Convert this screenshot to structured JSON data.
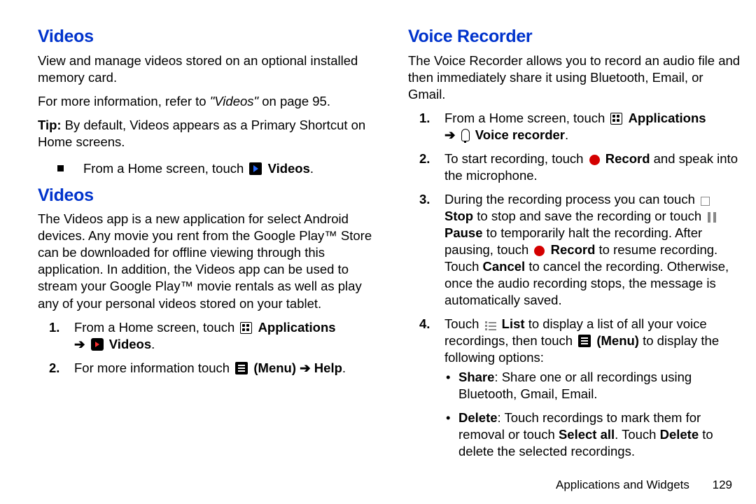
{
  "left": {
    "h1": "Videos",
    "p1": "View and manage videos stored on an optional installed memory card.",
    "p2a": "For more information, refer to ",
    "p2b": "\"Videos\"",
    "p2c": " on page 95.",
    "tipLabel": "Tip:",
    "tipBody": "By default, Videos appears as a Primary Shortcut on Home screens.",
    "bulletA": "From a Home screen, touch ",
    "bulletA_bold": "Videos",
    "h2": "Videos",
    "p3": "The Videos app is a new application for select Android devices. Any movie you rent from the Google Play™ Store can be downloaded for offline viewing through this application. In addition, the Videos app can be used to stream your Google Play™ movie rentals as well as play any of your personal videos stored on your tablet.",
    "s1_a": "From a Home screen, touch ",
    "s1_apps": "Applications",
    "s1_arrow": "➔",
    "s1_vid": "Videos",
    "s2_a": "For more information touch ",
    "s2_menu": "(Menu)",
    "s2_arrow": "➔",
    "s2_help": "Help"
  },
  "right": {
    "h1": "Voice Recorder",
    "p1": "The Voice Recorder allows you to record an audio file and then immediately share it using Bluetooth, Email, or Gmail.",
    "s1_a": "From a Home screen, touch ",
    "s1_apps": "Applications",
    "s1_arrow": "➔",
    "s1_vr": "Voice recorder",
    "s2_a": "To start recording, touch ",
    "s2_rec": "Record",
    "s2_b": " and speak into the microphone.",
    "s3_a": "During the recording process you can touch ",
    "s3_stop": "Stop",
    "s3_b": " to stop and save the recording or touch ",
    "s3_pause": "Pause",
    "s3_c": " to temporarily halt the recording. After pausing, touch ",
    "s3_rec": "Record",
    "s3_d": " to resume recording. Touch ",
    "s3_cancel": "Cancel",
    "s3_e": " to cancel the recording. Otherwise, once the audio recording stops, the message is automatically saved.",
    "s4_a": "Touch ",
    "s4_list": "List",
    "s4_b": " to display a list of all your voice recordings, then touch ",
    "s4_menu": "(Menu)",
    "s4_c": " to display the following options:",
    "b1_label": "Share",
    "b1_body": ": Share one or all recordings using Bluetooth, Gmail, Email.",
    "b2_label": "Delete",
    "b2_body_a": ": Touch recordings to mark them for removal or touch ",
    "b2_sel": "Select all",
    "b2_body_b": ". Touch ",
    "b2_del": "Delete",
    "b2_body_c": " to delete the selected recordings."
  },
  "footer": {
    "section": "Applications and Widgets",
    "page": "129"
  }
}
